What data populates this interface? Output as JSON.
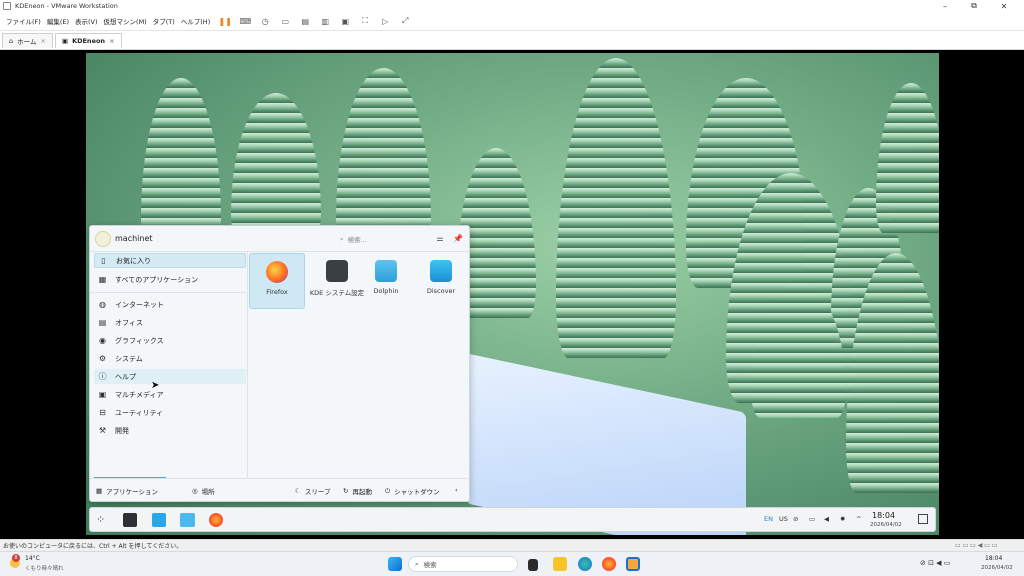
{
  "window": {
    "title": "KDEneon - VMware Workstation",
    "min": "–",
    "max": "⧉",
    "close": "✕"
  },
  "menubar": {
    "items": [
      "ファイル(F)",
      "編集(E)",
      "表示(V)",
      "仮想マシン(M)",
      "タブ(T)",
      "ヘルプ(H)"
    ]
  },
  "tabs": [
    {
      "label": "ホーム"
    },
    {
      "label": "KDEneon"
    }
  ],
  "kickoff": {
    "username": "machinet",
    "search_placeholder": "検索...",
    "categories_top": [
      "お気に入り",
      "すべてのアプリケーション"
    ],
    "categories": [
      "インターネット",
      "オフィス",
      "グラフィックス",
      "システム",
      "ヘルプ",
      "マルチメディア",
      "ユーティリティ",
      "開発"
    ],
    "apps": [
      {
        "label": "Firefox",
        "icon": "firefox-icon"
      },
      {
        "label": "KDE システム設定",
        "icon": "settings-icon"
      },
      {
        "label": "Dolphin",
        "icon": "folder-icon"
      },
      {
        "label": "Discover",
        "icon": "discover-icon"
      }
    ],
    "footer": {
      "applications": "アプリケーション",
      "places": "場所",
      "sleep": "スリープ",
      "restart": "再起動",
      "shutdown": "シャットダウン"
    }
  },
  "panel": {
    "lang": "EN",
    "layout": "US",
    "time": "18:04",
    "date": "2026/04/02"
  },
  "statusbar": {
    "text": "お使いのコンピュータに戻るには、Ctrl + Alt を押してください。"
  },
  "taskbar": {
    "weather_temp": "14°C",
    "weather_desc": "くもり時々晴れ",
    "weather_badge": "8",
    "search_label": "検索",
    "time": "18:04",
    "date": "2026/04/02"
  }
}
